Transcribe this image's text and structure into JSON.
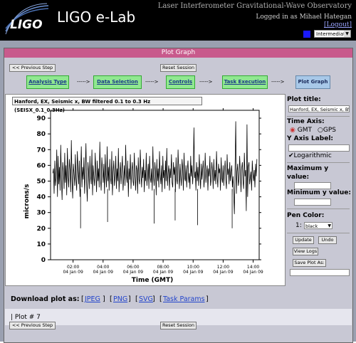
{
  "header": {
    "app_title": "LIGO e-Lab",
    "logo_text": "LIGO",
    "observatory": "Laser Interferometer Gravitational-Wave Observatory",
    "logged_in": "Logged in as Mihael Hategan",
    "logout": "[Logout]",
    "level": "Intermediate",
    "level_color": "#1a1aff"
  },
  "panel": {
    "title": "Plot Graph",
    "prev_step": "<< Previous Step",
    "reset": "Reset Session",
    "steps": [
      "Analysis Type",
      "Data Selection",
      "Controls",
      "Task Execution",
      "Plot Graph"
    ],
    "arrow": "----->"
  },
  "plot": {
    "caption": "Hanford, EX, Seismic x, BW filtered 0.1 to 0.3 Hz (SEISX_0.1_0.3Hz)"
  },
  "controls": {
    "plot_title_label": "Plot title:",
    "plot_title_value": "Hanford, EX, Seismic x, BW",
    "time_axis_label": "Time Axis:",
    "gmt": "GMT",
    "gps": "GPS",
    "y_axis_label": "Y Axis Label:",
    "y_axis_value": "",
    "logarithmic": "Logarithmic",
    "max_y_label_1": "Maximum y",
    "max_y_label_2": "value:",
    "min_y_label": "Minimum y value:",
    "pen_color_label": "Pen Color:",
    "pen_index": "1:",
    "pen_value": "black",
    "update": "Update",
    "undo": "Undo",
    "view_logs": "View Logs",
    "save_plot": "Save Plot As:"
  },
  "download": {
    "label": "Download plot as:",
    "links": [
      "JPEG",
      "PNG",
      "SVG",
      "Task Params"
    ]
  },
  "plot_number": "|  Plot # 7",
  "chart_data": {
    "type": "line",
    "title": "",
    "xlabel": "Time (GMT)",
    "ylabel": "microns/s",
    "ylim": [
      0,
      95
    ],
    "yticks": [
      0,
      10,
      20,
      30,
      40,
      50,
      60,
      70,
      80,
      90
    ],
    "xticks": [
      {
        "time": "02:00",
        "date": "04 Jan 09"
      },
      {
        "time": "04:00",
        "date": "04 Jan 09"
      },
      {
        "time": "06:00",
        "date": "04 Jan 09"
      },
      {
        "time": "08:00",
        "date": "04 Jan 09"
      },
      {
        "time": "10:00",
        "date": "04 Jan 09"
      },
      {
        "time": "12:00",
        "date": "04 Jan 09"
      },
      {
        "time": "14:00",
        "date": "04 Jan 09"
      }
    ],
    "xlim_hours": [
      0.5,
      14.4
    ],
    "series": [
      {
        "values": [
          55,
          58,
          42,
          63,
          47,
          52,
          70,
          40,
          66,
          48,
          59,
          44,
          73,
          51,
          38,
          62,
          56,
          45,
          68,
          49,
          60,
          41,
          71,
          53,
          46,
          64,
          57,
          43,
          76,
          50,
          39,
          61,
          55,
          47,
          67,
          52,
          44,
          69,
          58,
          48,
          63,
          40,
          54,
          72,
          46,
          59,
          51,
          65,
          42,
          57,
          74,
          49,
          37,
          62,
          56,
          45,
          66,
          53,
          48,
          70,
          41,
          60,
          52,
          47,
          68,
          55,
          43,
          63,
          50,
          58,
          46,
          75,
          51,
          44,
          65,
          57,
          49,
          61,
          42,
          67,
          54,
          46,
          72,
          50,
          59,
          44,
          64,
          52,
          48,
          69,
          41,
          56,
          63,
          47,
          53,
          66,
          45,
          58,
          50,
          71,
          43,
          55,
          62,
          48,
          57,
          66,
          44,
          52,
          60,
          47,
          73,
          54,
          49,
          63,
          40,
          58,
          51,
          67,
          45,
          56,
          62,
          50,
          47,
          68,
          53,
          44,
          60,
          57,
          42,
          65,
          51,
          48,
          70,
          55,
          46,
          59,
          52,
          64,
          43,
          57,
          50,
          68,
          47,
          54,
          61,
          45,
          66,
          52,
          49,
          58,
          44,
          72,
          53,
          47,
          62,
          56,
          41,
          64,
          50,
          58,
          46,
          69,
          54,
          48,
          60,
          43,
          66,
          52,
          57,
          45,
          63,
          50,
          71,
          47,
          55,
          60,
          44,
          58,
          52,
          67,
          49,
          46,
          62,
          54,
          59,
          43,
          65,
          51,
          48,
          70,
          56,
          45,
          61,
          53,
          47,
          64,
          58,
          44,
          68,
          52,
          50,
          60,
          46,
          57,
          63,
          49,
          55,
          45,
          66,
          53,
          60,
          48,
          58,
          84,
          52,
          56,
          44,
          62,
          50,
          59,
          47,
          67,
          54,
          45,
          61,
          51,
          57,
          63,
          46,
          52,
          68,
          49,
          55,
          60,
          44,
          58,
          53,
          66,
          47,
          51,
          62,
          56,
          45,
          64,
          50,
          57,
          48,
          69,
          53,
          46,
          61,
          55,
          58,
          44,
          65,
          52,
          49,
          60,
          47,
          56,
          63,
          51,
          45,
          67,
          54,
          58,
          48,
          62,
          50,
          55,
          60,
          46,
          53,
          41,
          29,
          57,
          88,
          42,
          56,
          61,
          47,
          51,
          66,
          55,
          43,
          58,
          62,
          50,
          45,
          68,
          53,
          57,
          31,
          86,
          40,
          59,
          62,
          48,
          52,
          56,
          44,
          63,
          54,
          50,
          57,
          46,
          61,
          53,
          64
        ]
      }
    ],
    "spikes": [
      {
        "x_hour": 2.5,
        "value": 20
      },
      {
        "x_hour": 4.3,
        "value": 24
      },
      {
        "x_hour": 7.4,
        "value": 23
      },
      {
        "x_hour": 8.8,
        "value": 25
      },
      {
        "x_hour": 10.3,
        "value": 22
      },
      {
        "x_hour": 12.6,
        "value": 20
      }
    ]
  }
}
